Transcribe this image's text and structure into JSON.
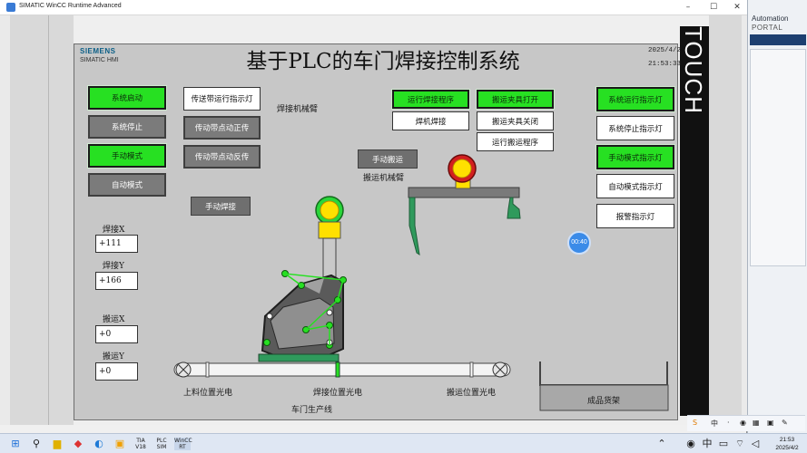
{
  "window": {
    "title": "SIMATIC WinCC Runtime Advanced",
    "minimize": "–",
    "maximize": "☐",
    "close": "✕"
  },
  "background_app": {
    "name": "Automation",
    "sub": "PORTAL"
  },
  "hmi": {
    "brand": "SIEMENS",
    "brand_sub": "SIMATIC HMI",
    "title": "基于PLC的车门焊接控制系统",
    "date": "2025/4/2",
    "time": "21:53:33",
    "touch_label": "TOUCH",
    "left_buttons": [
      {
        "label": "系统启动",
        "color": "green"
      },
      {
        "label": "系统停止",
        "color": "grey"
      },
      {
        "label": "手动模式",
        "color": "green"
      },
      {
        "label": "自动模式",
        "color": "grey"
      }
    ],
    "conveyor_buttons": {
      "indicator": "传送带运行指示灯",
      "jog_fwd": "传动带点动正传",
      "jog_rev": "传动带点动反传"
    },
    "manual_weld": "手动焊接",
    "weld_arm_label": "焊接机械臂",
    "manual_transport": "手动搬运",
    "transport_arm_label": "搬运机械臂",
    "top_buttons": {
      "run_weld": "运行焊接程序",
      "weld": "焊机焊接",
      "clamp_open": "搬运夹具打开",
      "clamp_close": "搬运夹具关闭",
      "run_transport": "运行搬运程序"
    },
    "right_indicators": [
      {
        "label": "系统运行指示灯",
        "color": "green"
      },
      {
        "label": "系统停止指示灯",
        "color": "white"
      },
      {
        "label": "手动模式指示灯",
        "color": "green"
      },
      {
        "label": "自动模式指示灯",
        "color": "white"
      },
      {
        "label": "报警指示灯",
        "color": "white"
      }
    ],
    "coords": {
      "weld_x_label": "焊接X",
      "weld_x": "+111",
      "weld_y_label": "焊接Y",
      "weld_y": "+166",
      "trans_x_label": "搬运X",
      "trans_x": "+0",
      "trans_y_label": "搬运Y",
      "trans_y": "+0"
    },
    "sensors": {
      "load": "上料位置光电",
      "weld": "焊接位置光电",
      "transport": "搬运位置光电"
    },
    "line_label": "车门生产线",
    "shelf_label": "成品货架",
    "timer_bubble": "00:40",
    "colors": {
      "accent_green": "#27e022",
      "lamp_yellow": "#ffe000",
      "lamp_red": "#d21f1f",
      "arm_green": "#2f9a5c",
      "screen_bg": "#c7c7c7"
    }
  },
  "taskbar": {
    "time": "21:53",
    "date": "2025/4/2",
    "ime": "中",
    "apps": [
      "TIA V18",
      "PLC SIM",
      "WinCC RT"
    ]
  }
}
